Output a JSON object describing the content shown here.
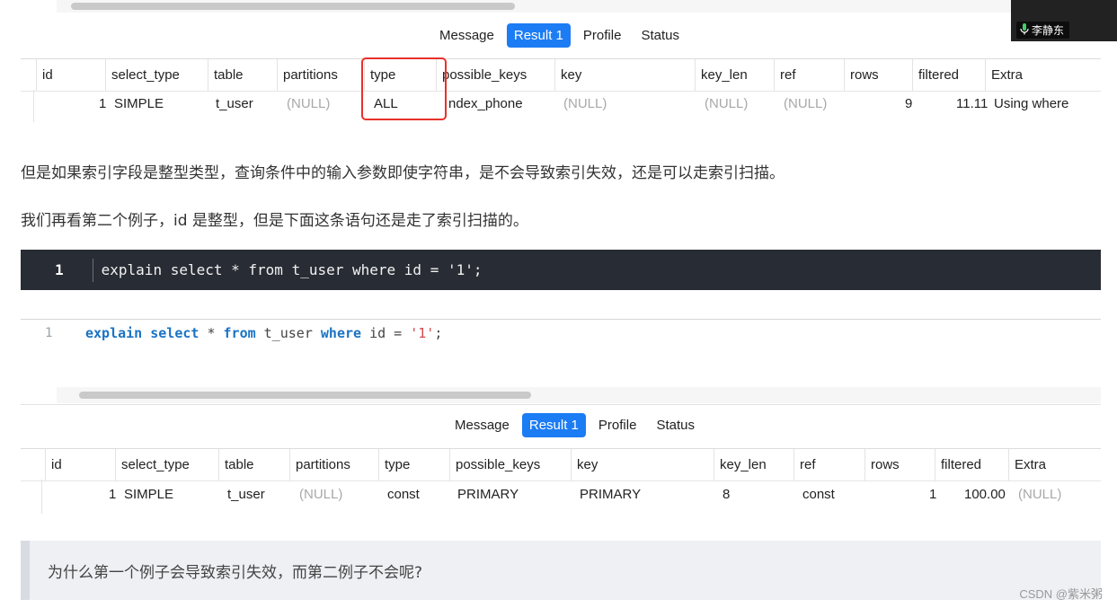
{
  "result1": {
    "tabs": [
      "Message",
      "Result 1",
      "Profile",
      "Status"
    ],
    "active_tab": "Result 1",
    "columns": [
      "id",
      "select_type",
      "table",
      "partitions",
      "type",
      "possible_keys",
      "key",
      "key_len",
      "ref",
      "rows",
      "filtered",
      "Extra"
    ],
    "row": {
      "id": "1",
      "select_type": "SIMPLE",
      "table": "t_user",
      "partitions": "(NULL)",
      "type": "ALL",
      "possible_keys": "ndex_phone",
      "key": "(NULL)",
      "key_len": "(NULL)",
      "ref": "(NULL)",
      "rows": "9",
      "filtered": "11.11",
      "extra": "Using where"
    },
    "highlight_color": "#e8312a"
  },
  "article": {
    "para1": "但是如果索引字段是整型类型，查询条件中的输入参数即使字符串，是不会导致索引失效，还是可以走索引扫描。",
    "para2": "我们再看第二个例子，id 是整型，但是下面这条语句还是走了索引扫描的。"
  },
  "code_block": {
    "line_no": "1",
    "code": "explain select * from t_user where id = '1';"
  },
  "editor": {
    "line_no": "1",
    "tokens": {
      "explain": "explain",
      "select": "select",
      "star": " * ",
      "from": "from",
      "table": " t_user ",
      "where": "where",
      "cond": " id = ",
      "value": "'1'",
      "end": ";"
    }
  },
  "result2": {
    "tabs": [
      "Message",
      "Result 1",
      "Profile",
      "Status"
    ],
    "active_tab": "Result 1",
    "columns": [
      "id",
      "select_type",
      "table",
      "partitions",
      "type",
      "possible_keys",
      "key",
      "key_len",
      "ref",
      "rows",
      "filtered",
      "Extra"
    ],
    "row": {
      "id": "1",
      "select_type": "SIMPLE",
      "table": "t_user",
      "partitions": "(NULL)",
      "type": "const",
      "possible_keys": "PRIMARY",
      "key": "PRIMARY",
      "key_len": "8",
      "ref": "const",
      "rows": "1",
      "filtered": "100.00",
      "extra": "(NULL)"
    }
  },
  "quote": {
    "text": "为什么第一个例子会导致索引失效，而第二例子不会呢?"
  },
  "watermark": "CSDN @紫米粥",
  "video": {
    "user": "李静东",
    "icon": "mic-icon"
  },
  "colors": {
    "tab_active": "#1c7cf4",
    "code_bg": "#282c34",
    "keyword": "#1a73c4",
    "string": "#d44950",
    "null_text": "#a8a8a8"
  }
}
